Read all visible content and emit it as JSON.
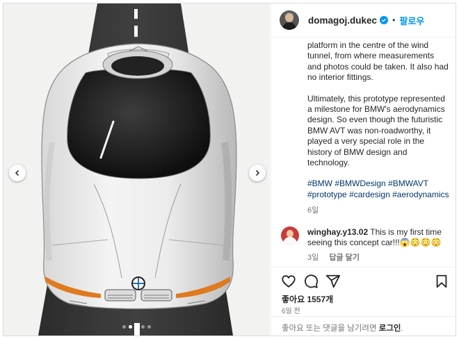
{
  "header": {
    "username": "domagoj.dukec",
    "separator": "•",
    "follow_label": "팔로우"
  },
  "caption": {
    "paragraph1": "platform in the centre of the wind tunnel, from where measurements and photos could be taken. It also had no interior fittings.",
    "paragraph2": "Ultimately, this prototype represented a milestone for BMW's aerodynamics design. So even though the futuristic BMW AVT was non-roadworthy, it played a very special role in the history of BMW design and technology.",
    "hashtags": [
      "#BMW",
      "#BMWDesign",
      "#BMWAVT",
      "#prototype",
      "#cardesign",
      "#aerodynamics"
    ],
    "time": "6일"
  },
  "comment": {
    "username": "winghay.y13.02",
    "text": "This is my first time seeing this concept car!!!😱😳😳😳",
    "time": "3일",
    "reply_label": "답글 달기"
  },
  "actions": {
    "likes": "좋아요 1557개",
    "date": "6일 전"
  },
  "login_prompt": {
    "text": "좋아요 또는 댓글을 남기려면",
    "link": "로그인",
    "suffix": "."
  },
  "carousel": {
    "slide_count": 5,
    "active_index": 1
  },
  "colors": {
    "accent": "#0095f6",
    "hashtag": "#00376b",
    "muted": "#737373",
    "tail_light": "#e07a1f"
  }
}
